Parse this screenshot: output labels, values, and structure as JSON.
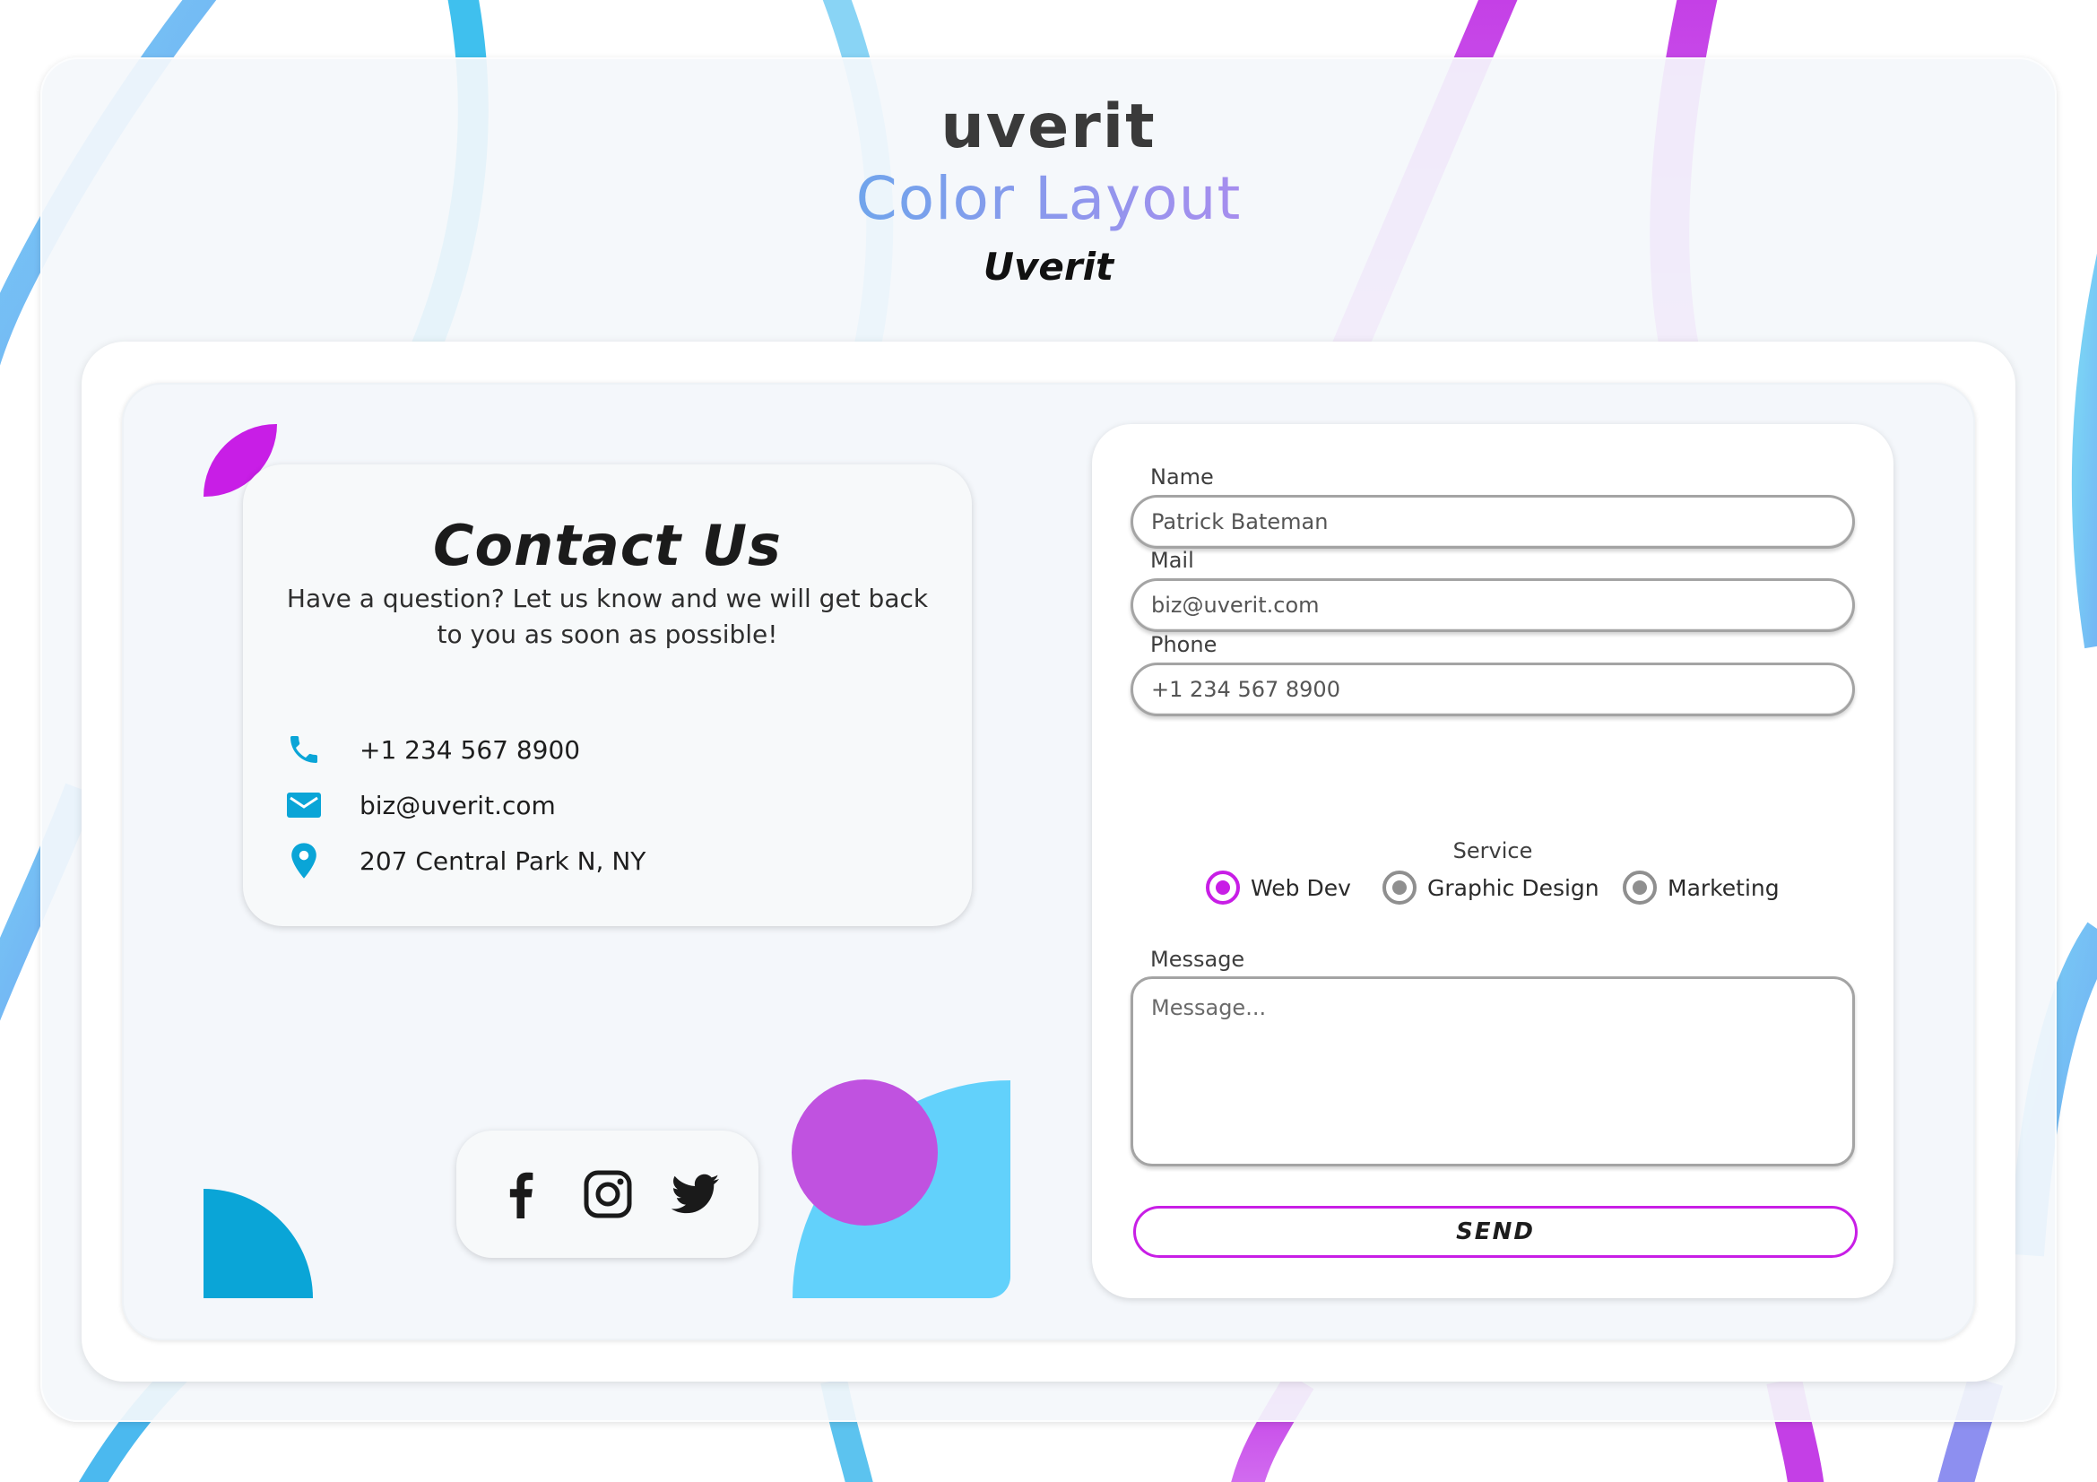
{
  "colors": {
    "magenta": "#c81ee6",
    "blue": "#0aa5d7",
    "cyan": "#62d1fb",
    "purple": "#c052e0",
    "panel": "#f4f7fb"
  },
  "header": {
    "logo_text": "uverit",
    "subtitle": "Color Layout",
    "brand_name": "Uverit"
  },
  "contact": {
    "title": "Contact Us",
    "description": "Have a question? Let us know and we will get back to you as soon as possible!",
    "items": [
      {
        "icon": "phone-icon",
        "text": "+1 234 567 8900"
      },
      {
        "icon": "mail-icon",
        "text": "biz@uverit.com"
      },
      {
        "icon": "location-pin-icon",
        "text": "207 Central Park N, NY"
      }
    ]
  },
  "social": [
    {
      "icon": "facebook-icon"
    },
    {
      "icon": "instagram-icon"
    },
    {
      "icon": "twitter-icon"
    }
  ],
  "form": {
    "name_label": "Name",
    "name_value": "Patrick Bateman",
    "mail_label": "Mail",
    "mail_value": "biz@uverit.com",
    "phone_label": "Phone",
    "phone_value": "+1 234 567 8900",
    "service_label": "Service",
    "services": [
      {
        "label": "Web Dev",
        "selected": true
      },
      {
        "label": "Graphic Design",
        "selected": false
      },
      {
        "label": "Marketing",
        "selected": false
      }
    ],
    "message_label": "Message",
    "message_placeholder": "Message...",
    "send_label": "SEND"
  }
}
